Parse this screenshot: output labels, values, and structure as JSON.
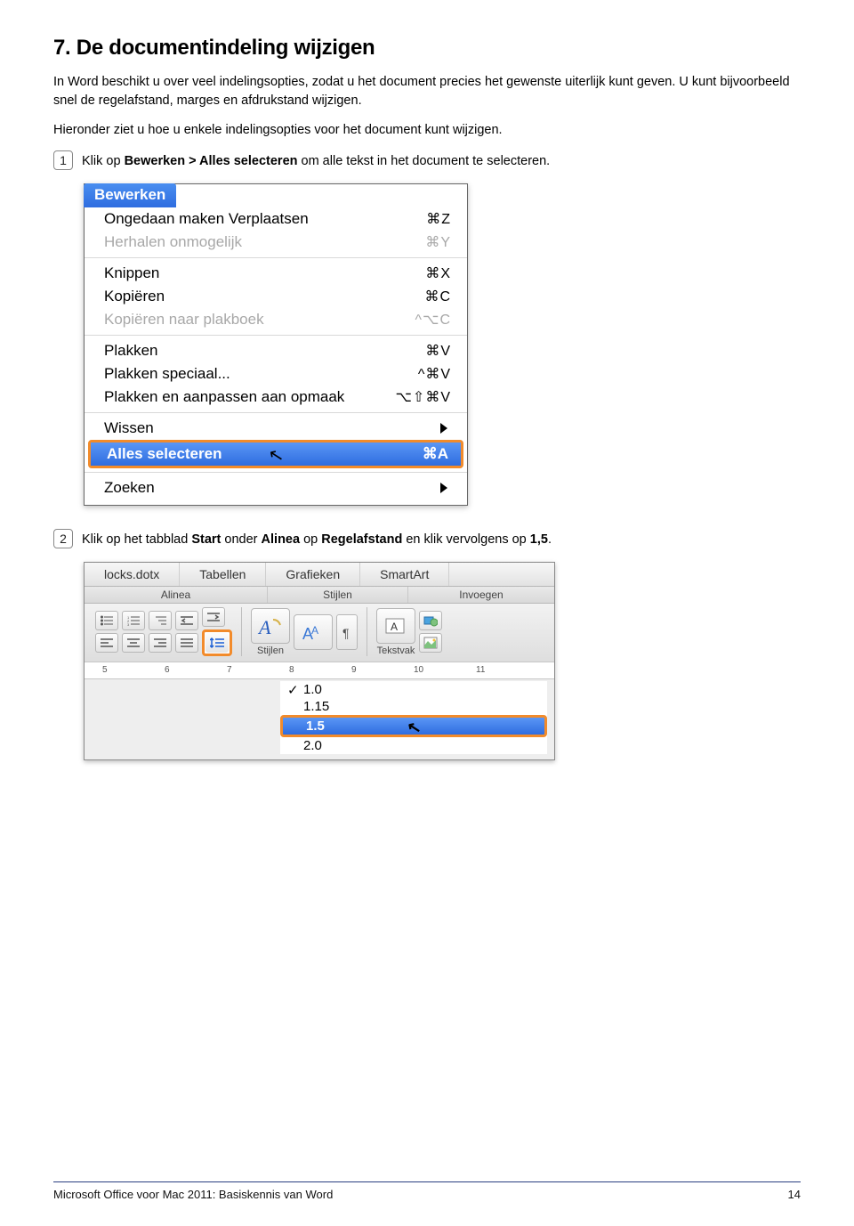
{
  "heading": "7. De documentindeling wijzigen",
  "p1": "In Word beschikt u over veel indelingsopties, zodat u het document precies het gewenste uiterlijk kunt geven. U kunt bijvoorbeeld snel de regelafstand, marges en afdrukstand wijzigen.",
  "p2": "Hieronder ziet u hoe u enkele indelingsopties voor het document kunt wijzigen.",
  "step1": {
    "num": "1",
    "pre": "Klik op ",
    "bold": "Bewerken > Alles selecteren",
    "post": " om alle tekst in het document te selecteren."
  },
  "menu": {
    "title": "Bewerken",
    "rows": [
      {
        "label": "Ongedaan maken Verplaatsen",
        "sc": "⌘Z"
      },
      {
        "label": "Herhalen onmogelijk",
        "sc": "⌘Y",
        "disabled": true
      },
      {
        "sep": true
      },
      {
        "label": "Knippen",
        "sc": "⌘X"
      },
      {
        "label": "Kopiëren",
        "sc": "⌘C"
      },
      {
        "label": "Kopiëren naar plakboek",
        "sc": "^⌥C",
        "disabled": true
      },
      {
        "sep": true
      },
      {
        "label": "Plakken",
        "sc": "⌘V"
      },
      {
        "label": "Plakken speciaal...",
        "sc": "^⌘V"
      },
      {
        "label": "Plakken en aanpassen aan opmaak",
        "sc": "⌥⇧⌘V"
      },
      {
        "sep": true
      },
      {
        "label": "Wissen",
        "sub": true
      }
    ],
    "highlight": {
      "label": "Alles selecteren",
      "sc": "⌘A"
    },
    "after": {
      "label": "Zoeken",
      "sub": true
    }
  },
  "step2": {
    "num": "2",
    "t1": "Klik op het tabblad ",
    "b1": "Start",
    "t2": " onder ",
    "b2": "Alinea",
    "t3": " op ",
    "b3": "Regelafstand",
    "t4": " en klik vervolgens op ",
    "b4": "1,5",
    "t5": "."
  },
  "ribbon": {
    "tabs": [
      "locks.dotx",
      "Tabellen",
      "Grafieken",
      "SmartArt"
    ],
    "groups": [
      "Alinea",
      "Stijlen",
      "Invoegen"
    ],
    "labels": {
      "stijlen": "Stijlen",
      "tekstvak": "Tekstvak"
    },
    "rulerTicks": [
      "5",
      "6",
      "7",
      "8",
      "9",
      "10",
      "11"
    ],
    "ls": [
      "1.0",
      "1.15",
      "1.5",
      "2.0"
    ]
  },
  "footer": {
    "left": "Microsoft Office voor Mac 2011: Basiskennis van Word",
    "right": "14"
  }
}
